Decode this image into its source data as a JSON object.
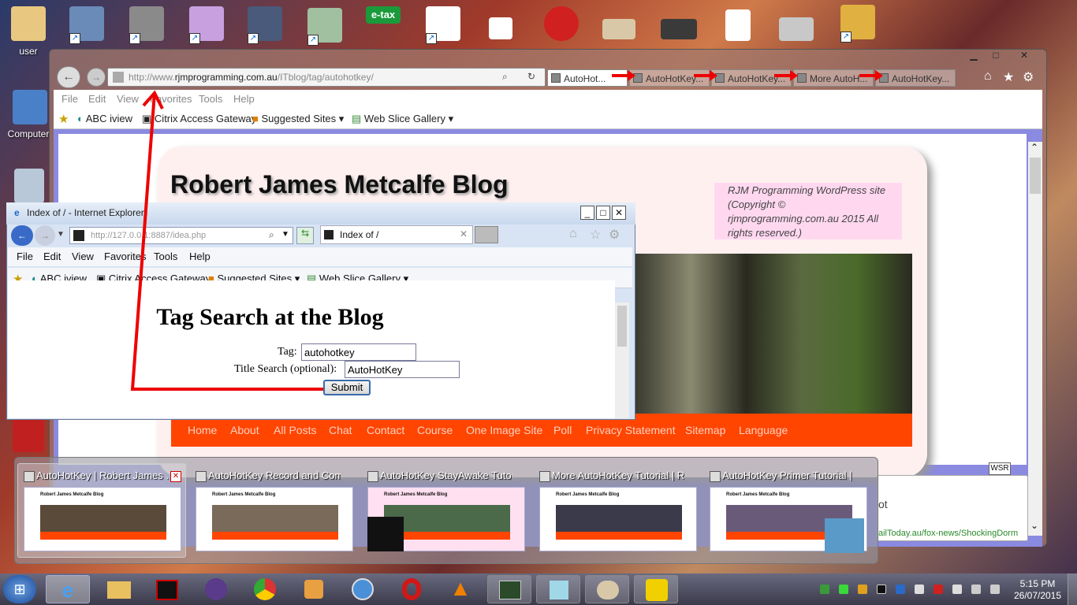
{
  "desktop": {
    "labels": {
      "user": "user",
      "computer": "Computer",
      "etax": "e-tax"
    }
  },
  "main_browser": {
    "address_prefix": "http://www.",
    "address_domain": "rjmprogramming.com.au",
    "address_path": "/ITblog/tag/autohotkey/",
    "tabs": [
      "AutoHot...",
      "AutoHotKey...",
      "AutoHotKey...",
      "More AutoH...",
      "AutoHotKey..."
    ],
    "menu": [
      "File",
      "Edit",
      "View",
      "Favorites",
      "Tools",
      "Help"
    ],
    "favorites": [
      "ABC iview",
      "Citrix Access Gateway",
      "Suggested Sites ▾",
      "Web Slice Gallery ▾"
    ],
    "blog_title": "Robert James Metcalfe Blog",
    "blog_copyright": "RJM Programming WordPress site (Copyright © rjmprogramming.com.au 2015 All rights reserved.)",
    "nav": [
      "Home",
      "About",
      "All Posts",
      "Chat",
      "Contact",
      "Course",
      "One Image Site",
      "Poll",
      "Privacy Statement",
      "Sitemap",
      "Language"
    ],
    "wsr": "WSR",
    "snippet_text": "ot",
    "snippet_link": "ailToday.au/fox-news/ShockingDorm"
  },
  "secondary_browser": {
    "title": "Index of / - Internet Explorer",
    "address": "http://127.0.0.1:8887/idea.php",
    "tab": "Index of /",
    "menu": [
      "File",
      "Edit",
      "View",
      "Favorites",
      "Tools",
      "Help"
    ],
    "favorites": [
      "ABC iview",
      "Citrix Access Gateway",
      "Suggested Sites ▾",
      "Web Slice Gallery ▾"
    ],
    "heading": "Tag Search at the Blog",
    "tag_label": "Tag:",
    "tag_value": "autohotkey",
    "title_label": "Title Search (optional):",
    "title_value": "AutoHotKey",
    "submit": "Submit"
  },
  "thumbnails": [
    {
      "title": "AutoHotKey | Robert James ...",
      "img": "#5a4a3a"
    },
    {
      "title": "AutoHotKey Record and Compi...",
      "img": "#7a6a5a"
    },
    {
      "title": "AutoHotKey StayAwake Tutorial...",
      "img": "#4a6a4a"
    },
    {
      "title": "More AutoHotKey Tutorial | Ro...",
      "img": "#3a3a4a"
    },
    {
      "title": "AutoHotKey Primer Tutorial | R...",
      "img": "#6a5a7a"
    }
  ],
  "blog_preview_title": "Robert James Metcalfe Blog",
  "clock": {
    "time": "5:15 PM",
    "date": "26/07/2015"
  }
}
